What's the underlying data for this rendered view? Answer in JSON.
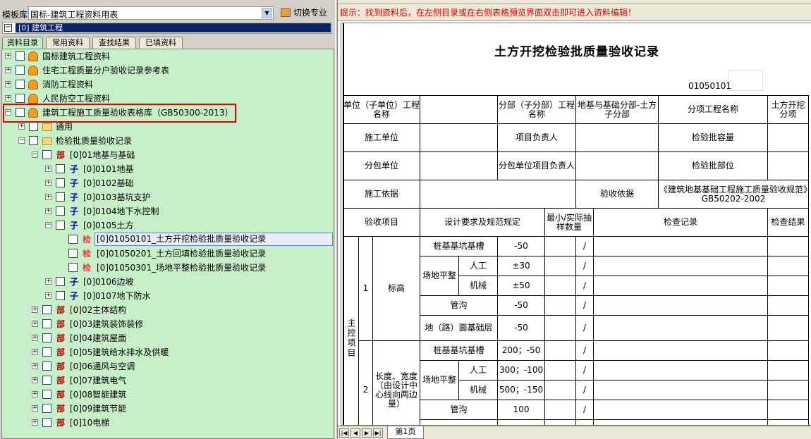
{
  "toolbar": {
    "template_label": "模板库",
    "template_value": "国标-建筑工程资料用表",
    "switch_label": "切换专业"
  },
  "root": {
    "label": "[0] 建筑工程"
  },
  "tabs": [
    "资料目录",
    "常用资料",
    "查找结果",
    "已填资料"
  ],
  "tree": {
    "n1": "国标建筑工程资料",
    "n2": "住宅工程质量分户验收记录参考表",
    "n3": "消防工程资料",
    "n4": "人民防空工程资料",
    "n5": "建筑工程施工质量验收表格库（GB50300-2013）",
    "n6": "通用",
    "n7": "检验批质量验收记录",
    "tag_bu": "部",
    "tag_zi": "子",
    "tag_jian": "检",
    "b1": "[0]01地基与基础",
    "z1": "[0]0101地基",
    "z2": "[0]0102基础",
    "z3": "[0]0103基坑支护",
    "z4": "[0]0104地下水控制",
    "z5": "[0]0105土方",
    "j1": "[0]01050101_土方开挖检验批质量验收记录",
    "j2": "[0]01050201_土方回填检验批质量验收记录",
    "j3": "[0]01050301_场地平整检验批质量验收记录",
    "z6": "[0]0106边坡",
    "z7": "[0]0107地下防水",
    "b2": "[0]02主体结构",
    "b3": "[0]03建筑装饰装修",
    "b4": "[0]04建筑屋面",
    "b5": "[0]05建筑给水排水及供暖",
    "b6": "[0]06通风与空调",
    "b7": "[0]07建筑电气",
    "b8": "[0]08智能建筑",
    "b9": "[0]09建筑节能",
    "b10": "[0]10电梯"
  },
  "hint": "提示：找到资料后，在左侧目录或在右侧表格预览界面双击即可进入资料编辑！",
  "doc": {
    "title": "土方开挖检验批质量验收记录",
    "number": "01050101",
    "r1": {
      "a": "单位（子单位）工程名称",
      "b": "分部（子分部）工程名称",
      "c": "地基与基础分部-土方子分部",
      "d": "分项工程名称",
      "e": "土方开挖分项"
    },
    "r2": {
      "a": "施工单位",
      "b": "项目负责人",
      "c": "检验批容量"
    },
    "r3": {
      "a": "分包单位",
      "b": "分包单位项目负责人",
      "c": "检验批部位"
    },
    "r4": {
      "a": "施工依据",
      "b": "验收依据",
      "c": "《建筑地基基础工程施工质量验收规范》GB50202-2002"
    },
    "hdr": {
      "a": "验收项目",
      "b": "设计要求及规范规定",
      "c": "最小/实际抽样数量",
      "d": "检查记录",
      "e": "检查结果"
    },
    "main_ctrl": "主控项目",
    "slash": "/",
    "item1": {
      "no": "1",
      "name": "标高",
      "r1": "桩基基坑基槽",
      "v1": "-50",
      "site": "场地平整",
      "manual": "人工",
      "v2": "±30",
      "machine": "机械",
      "v3": "±50",
      "ditch": "管沟",
      "v4": "-50",
      "ground": "地（路）面基础层",
      "v5": "-50"
    },
    "item2": {
      "no": "2",
      "name": "长度、宽度（由设计中心线向两边量）",
      "r1": "桩基基坑基槽",
      "v1": "200；-50",
      "site": "场地平整",
      "manual": "人工",
      "v2": "300；-100",
      "machine": "机械",
      "v3": "500；-150",
      "ditch": "管沟",
      "v4": "100"
    }
  },
  "sheet": {
    "tab": "第1页"
  }
}
